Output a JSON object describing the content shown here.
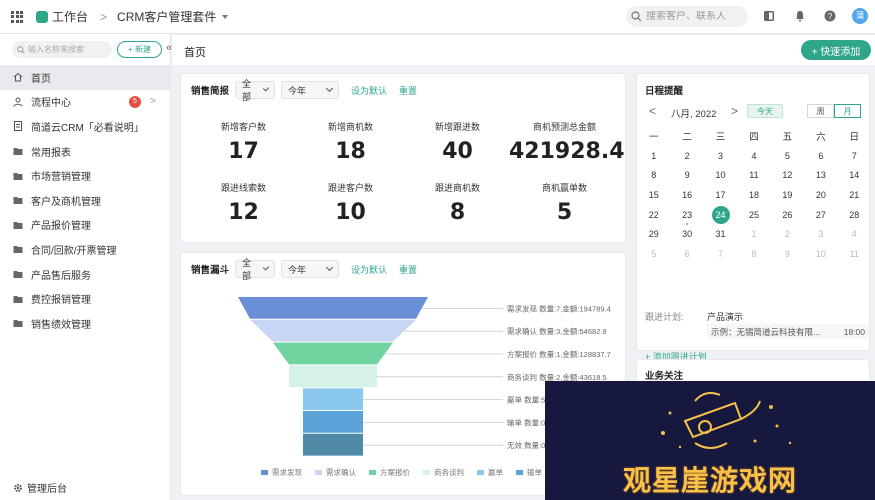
{
  "topbar": {
    "workspace_label": "工作台",
    "separator": ">",
    "app_title": "CRM客户管理套件",
    "search_placeholder": "搜索客户、联系人",
    "avatar_text": "蒲"
  },
  "sidebar": {
    "search_placeholder": "输入名称来搜索",
    "new_label": "+ 新建",
    "collapse": "«",
    "items": [
      {
        "label": "首页",
        "icon": "home-icon",
        "active": true
      },
      {
        "label": "流程中心",
        "icon": "flow-icon",
        "badge": "5",
        "arrow": ">"
      },
      {
        "label": "简道云CRM「必看说明」",
        "icon": "doc-icon"
      },
      {
        "label": "常用报表",
        "icon": "folder-icon"
      },
      {
        "label": "市场营销管理",
        "icon": "folder-icon"
      },
      {
        "label": "客户及商机管理",
        "icon": "folder-icon"
      },
      {
        "label": "产品报价管理",
        "icon": "folder-icon"
      },
      {
        "label": "合同/回款/开票管理",
        "icon": "folder-icon"
      },
      {
        "label": "产品售后服务",
        "icon": "folder-icon"
      },
      {
        "label": "费控报销管理",
        "icon": "folder-icon"
      },
      {
        "label": "销售绩效管理",
        "icon": "folder-icon"
      }
    ],
    "admin_label": "管理后台"
  },
  "header": {
    "title": "首页",
    "quick_add": "+ 快速添加"
  },
  "sales_brief": {
    "title": "销售简报",
    "scope": "全部",
    "period": "今年",
    "set_default": "设为默认",
    "reset": "重置",
    "stats": [
      {
        "label": "新增客户数",
        "value": "17"
      },
      {
        "label": "新增商机数",
        "value": "18"
      },
      {
        "label": "新增跟进数",
        "value": "40"
      },
      {
        "label": "商机预测总金额",
        "value": "421928.4"
      },
      {
        "label": "跟进线索数",
        "value": "12"
      },
      {
        "label": "跟进客户数",
        "value": "10"
      },
      {
        "label": "跟进商机数",
        "value": "8"
      },
      {
        "label": "商机赢单数",
        "value": "5"
      }
    ]
  },
  "funnel": {
    "title": "销售漏斗",
    "scope": "全部",
    "period": "今年",
    "set_default": "设为默认",
    "reset": "重置"
  },
  "chart_data": {
    "type": "funnel",
    "stages": [
      {
        "name": "需求发现",
        "label": "需求发现 数量:7,金额:194789.4",
        "color": "#6b8fd6"
      },
      {
        "name": "需求确认",
        "label": "需求确认 数量:3,金额:54682.8",
        "color": "#c9d6f3"
      },
      {
        "name": "方案报价",
        "label": "方案报价 数量:1,金额:128837.7",
        "color": "#6fd4a0"
      },
      {
        "name": "商务谈判",
        "label": "商务谈判 数量:2,金额:43618.5",
        "color": "#d4f2e7"
      },
      {
        "name": "赢单",
        "label": "赢单 数量:5",
        "color": "#8ac7ee"
      },
      {
        "name": "输单",
        "label": "输单 数量:0",
        "color": "#5ba2d9"
      },
      {
        "name": "无效",
        "label": "无效 数量:0",
        "color": "#4f8ba6"
      }
    ],
    "legend": [
      "需求发现",
      "需求确认",
      "方案报价",
      "商务谈判",
      "赢单",
      "输单",
      "无效"
    ]
  },
  "calendar": {
    "title": "日程提醒",
    "prev": "<",
    "next": ">",
    "month": "八月, 2022",
    "today_label": "今天",
    "week_label": "周",
    "month_label": "月",
    "weekdays": [
      "一",
      "二",
      "三",
      "四",
      "五",
      "六",
      "日"
    ],
    "weeks": [
      [
        "1",
        "2",
        "3",
        "4",
        "5",
        "6",
        "7"
      ],
      [
        "8",
        "9",
        "10",
        "11",
        "12",
        "13",
        "14"
      ],
      [
        "15",
        "16",
        "17",
        "18",
        "19",
        "20",
        "21"
      ],
      [
        "22",
        "23",
        "24",
        "25",
        "26",
        "27",
        "28"
      ],
      [
        "29",
        "30",
        "31",
        "1",
        "2",
        "3",
        "4"
      ],
      [
        "5",
        "6",
        "7",
        "8",
        "9",
        "10",
        "11"
      ]
    ],
    "today": "24",
    "plan_label": "跟进计划:",
    "plan_name": "产品演示",
    "plan_text": "示例：无锡简道云科技有限...",
    "plan_time": "18:00",
    "add_plan": "+ 添加跟进计划"
  },
  "business_focus": {
    "title": "业务关注"
  },
  "overlay": {
    "text": "观星崖游戏网"
  }
}
